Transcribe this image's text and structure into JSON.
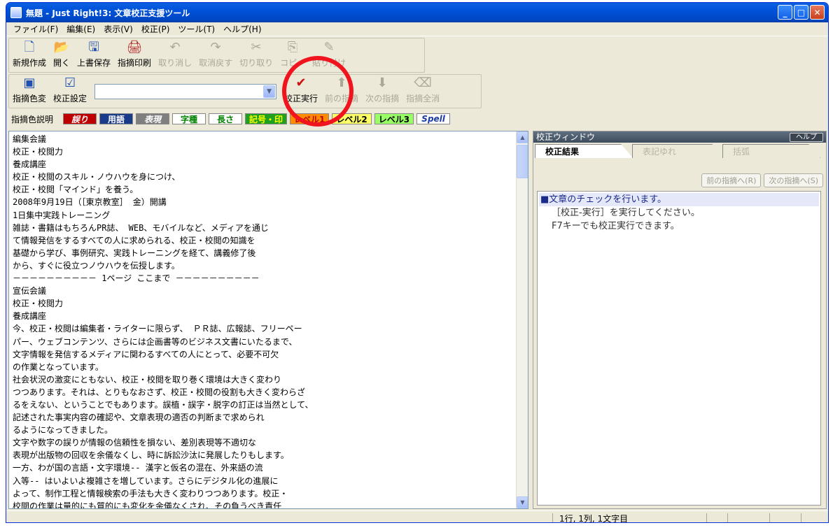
{
  "window": {
    "title": "無題 - Just Right!3: 文章校正支援ツール"
  },
  "menubar": [
    "ファイル(F)",
    "編集(E)",
    "表示(V)",
    "校正(P)",
    "ツール(T)",
    "ヘルプ(H)"
  ],
  "toolbar1": [
    {
      "label": "新規作成",
      "icon": "new-document-icon",
      "glyph": "🗋"
    },
    {
      "label": "開く",
      "icon": "open-folder-icon",
      "glyph": "📂"
    },
    {
      "label": "上書保存",
      "icon": "save-icon",
      "glyph": "🖫"
    },
    {
      "label": "指摘印刷",
      "icon": "print-icon",
      "glyph": "🖨"
    },
    {
      "label": "取り消し",
      "icon": "undo-icon",
      "glyph": "↶"
    },
    {
      "label": "取消戻す",
      "icon": "redo-icon",
      "glyph": "↷"
    },
    {
      "label": "切り取り",
      "icon": "cut-icon",
      "glyph": "✂"
    },
    {
      "label": "コピー",
      "icon": "copy-icon",
      "glyph": "⎘"
    },
    {
      "label": "貼り付け",
      "icon": "paste-icon",
      "glyph": "✎"
    }
  ],
  "toolbar2": {
    "color_change": {
      "label": "指摘色変",
      "icon": "color-settings-icon",
      "glyph": "▣"
    },
    "settings": {
      "label": "校正設定",
      "icon": "proofread-settings-icon",
      "glyph": "☑"
    },
    "combo_value": "",
    "run": {
      "label": "校正実行",
      "icon": "run-check-icon",
      "glyph": "✔"
    },
    "prev": {
      "label": "前の指摘",
      "icon": "up-arrow-icon",
      "glyph": "⬆"
    },
    "next": {
      "label": "次の指摘",
      "icon": "down-arrow-icon",
      "glyph": "⬇"
    },
    "clear": {
      "label": "指摘全消",
      "icon": "clear-marks-icon",
      "glyph": "⌫"
    }
  },
  "legend": {
    "label": "指摘色説明",
    "chips": [
      {
        "text": "誤り",
        "bg": "#c00000",
        "fg": "#ffffff",
        "style": "italic"
      },
      {
        "text": "用語",
        "bg": "#1a3a8a",
        "fg": "#ffffff",
        "style": "normal"
      },
      {
        "text": "表現",
        "bg": "#7f7f7f",
        "fg": "#ffffff",
        "style": "italic"
      },
      {
        "text": "字種",
        "bg": "#ffffff",
        "fg": "#008000",
        "style": "normal"
      },
      {
        "text": "長さ",
        "bg": "#ffffff",
        "fg": "#008000",
        "style": "normal"
      },
      {
        "text": "記号・印",
        "bg": "#1fa01f",
        "fg": "#ffff00",
        "style": "normal"
      },
      {
        "text": "レベル1",
        "bg": "#ff8c00",
        "fg": "#c00000",
        "style": "normal"
      },
      {
        "text": "レベル2",
        "bg": "#ffff66",
        "fg": "#000000",
        "style": "normal"
      },
      {
        "text": "レベル3",
        "bg": "#99ff66",
        "fg": "#000000",
        "style": "normal"
      },
      {
        "text": "Spell",
        "bg": "#ffffff",
        "fg": "#1a3aa8",
        "style": "italic"
      }
    ]
  },
  "editor": {
    "lines": [
      "編集会議",
      "校正・校閲力",
      "養成講座",
      "校正・校閲のスキル・ノウハウを身につけ、",
      "校正・校閲「マインド」を養う。",
      "2008年9月19日（［東京教室］ 金）開講",
      "1日集中実践トレーニング",
      "雑誌・書籍はもちろんPR誌、 WEB、モバイルなど、メディアを通じ",
      "て情報発信をするすべての人に求められる、校正・校閲の知識を",
      "基礎から学び、事例研究、実践トレーニングを経て、講義修了後",
      "から、すぐに役立つノウハウを伝授します。",
      "－－－－－－－－－－ 1ページ ここまで －－－－－－－－－－",
      "宣伝会議",
      "校正・校閲力",
      "養成講座",
      "今、校正・校閲は編集者・ライターに限らず、 ＰＲ誌、広報誌、フリーペー",
      "パー、ウェブコンテンツ、さらには企画書等のビジネス文書にいたるまで、",
      "文字情報を発信するメディアに関わるすべての人にとって、必要不可欠",
      "の作業となっています。",
      "社会状況の激変にともない、校正・校閲を取り巻く環境は大きく変わり",
      "つつあります。それは、とりもなおさず、校正・校閲の役割も大きく変わらざ",
      "るをえない、ということでもあります。誤植・誤字・脱字の訂正は当然として、",
      "記述された事実内容の確認や、文章表現の適否の判断まで求められ",
      "るようになってきました。",
      "文字や数字の誤りが情報の信頼性を損ない、差別表現等不適切な",
      "表現が出版物の回収を余儀なくし、時に訴訟沙汰に発展したりもします。",
      "一方、わが国の言語・文字環境-- 漢字と仮名の混在、外来語の流",
      "入等-- はいよいよ複雑さを増しています。さらにデジタル化の進展に",
      "よって、制作工程と情報検索の手法も大きく変わりつつあります。校正・",
      "校閲の作業は量的にも質的にも変化を余儀なくされ、その負うべき責任"
    ]
  },
  "panel": {
    "title": "校正ウィンドウ",
    "help": "ヘルプ",
    "tabs": [
      "校正結果",
      "表記ゆれ",
      "括弧"
    ],
    "prev_btn": "前の指摘へ(R)",
    "next_btn": "次の指摘へ(S)",
    "result_head": "■文章のチェックを行います。",
    "result_lines": [
      "［校正-実行］を実行してください。",
      "F7キーでも校正実行できます。"
    ]
  },
  "status": {
    "position": "1行, 1列, 1文字目"
  }
}
